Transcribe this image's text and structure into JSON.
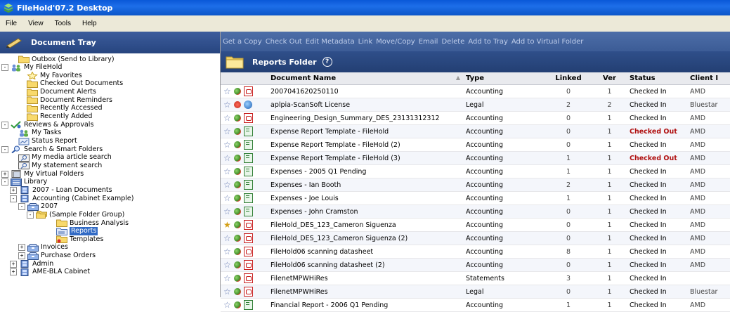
{
  "window": {
    "title": "FileHold'07.2 Desktop"
  },
  "menu": [
    "File",
    "View",
    "Tools",
    "Help"
  ],
  "tray": {
    "title": "Document Tray"
  },
  "tree": [
    {
      "label": "Outbox (Send to Library)",
      "icon": "folder-icon",
      "indent": 1,
      "expander": ""
    },
    {
      "label": "My FileHold",
      "icon": "users-icon",
      "indent": 0,
      "expander": "-"
    },
    {
      "label": "My Favorites",
      "icon": "star-icon",
      "indent": 2,
      "expander": ""
    },
    {
      "label": "Checked Out Documents",
      "icon": "folder-icon",
      "indent": 2,
      "expander": ""
    },
    {
      "label": "Document Alerts",
      "icon": "folder-icon",
      "indent": 2,
      "expander": ""
    },
    {
      "label": "Document Reminders",
      "icon": "folder-icon",
      "indent": 2,
      "expander": ""
    },
    {
      "label": "Recently Accessed",
      "icon": "folder-icon",
      "indent": 2,
      "expander": ""
    },
    {
      "label": "Recently Added",
      "icon": "folder-icon",
      "indent": 2,
      "expander": ""
    },
    {
      "label": "Reviews & Approvals",
      "icon": "approval-icon",
      "indent": 0,
      "expander": "-"
    },
    {
      "label": "My Tasks",
      "icon": "users-icon",
      "indent": 1,
      "expander": ""
    },
    {
      "label": "Status Report",
      "icon": "report-icon",
      "indent": 1,
      "expander": ""
    },
    {
      "label": "Search & Smart Folders",
      "icon": "search-icon",
      "indent": 0,
      "expander": "-"
    },
    {
      "label": "My media article search",
      "icon": "smart-folder-icon",
      "indent": 1,
      "expander": ""
    },
    {
      "label": "My statement search",
      "icon": "smart-folder-icon",
      "indent": 1,
      "expander": ""
    },
    {
      "label": "My Virtual Folders",
      "icon": "virtual-folder-icon",
      "indent": 0,
      "expander": "+"
    },
    {
      "label": "Library",
      "icon": "library-icon",
      "indent": 0,
      "expander": "-"
    },
    {
      "label": "2007 - Loan Documents",
      "icon": "cabinet-icon",
      "indent": 1,
      "expander": "+"
    },
    {
      "label": "Accounting (Cabinet Example)",
      "icon": "cabinet-icon",
      "indent": 1,
      "expander": "-"
    },
    {
      "label": "2007",
      "icon": "drawer-icon",
      "indent": 2,
      "expander": "-"
    },
    {
      "label": "(Sample Folder Group)",
      "icon": "folder-group-icon",
      "indent": 3,
      "expander": "-"
    },
    {
      "label": "Business Analysis",
      "icon": "folder-icon",
      "indent": 5,
      "expander": ""
    },
    {
      "label": "Reports",
      "icon": "folder-open-icon",
      "indent": 5,
      "expander": "",
      "selected": true
    },
    {
      "label": "Templates",
      "icon": "template-folder-icon",
      "indent": 5,
      "expander": ""
    },
    {
      "label": "Invoices",
      "icon": "drawer-icon",
      "indent": 2,
      "expander": "+"
    },
    {
      "label": "Purchase Orders",
      "icon": "drawer-icon",
      "indent": 2,
      "expander": "+"
    },
    {
      "label": "Admin",
      "icon": "cabinet-icon",
      "indent": 1,
      "expander": "+"
    },
    {
      "label": "AME-BLA Cabinet",
      "icon": "cabinet-icon",
      "indent": 1,
      "expander": "+"
    }
  ],
  "toolbar": [
    "Get a Copy",
    "Check Out",
    "Edit Metadata",
    "Link",
    "Move/Copy",
    "Email",
    "Delete",
    "Add to Tray",
    "Add to Virtual Folder"
  ],
  "folder": {
    "title": "Reports Folder"
  },
  "table": {
    "columns": [
      "Document Name",
      "Type",
      "Linked",
      "Ver",
      "Status",
      "Client I"
    ],
    "rows": [
      {
        "name": "2007041620250110",
        "type": "Accounting",
        "linked": "0",
        "ver": "1",
        "status": "Checked In",
        "client": "AMD",
        "doc": "pdf",
        "star": "blue",
        "status_icon": "green"
      },
      {
        "name": "aplpia-ScanSoft License",
        "type": "Legal",
        "linked": "2",
        "ver": "2",
        "status": "Checked In",
        "client": "Bluestar",
        "doc": "web",
        "star": "blue",
        "status_icon": "red"
      },
      {
        "name": "Engineering_Design_Summary_DES_23131312312",
        "type": "Accounting",
        "linked": "0",
        "ver": "1",
        "status": "Checked In",
        "client": "AMD",
        "doc": "pdf",
        "star": "blue",
        "status_icon": "green"
      },
      {
        "name": "Expense Report Template - FileHold",
        "type": "Accounting",
        "linked": "0",
        "ver": "1",
        "status": "Checked Out",
        "client": "AMD",
        "doc": "xls",
        "star": "blue",
        "status_icon": "green"
      },
      {
        "name": "Expense Report Template - FileHold (2)",
        "type": "Accounting",
        "linked": "0",
        "ver": "1",
        "status": "Checked In",
        "client": "AMD",
        "doc": "xls",
        "star": "blue",
        "status_icon": "green"
      },
      {
        "name": "Expense Report Template - FileHold (3)",
        "type": "Accounting",
        "linked": "1",
        "ver": "1",
        "status": "Checked Out",
        "client": "AMD",
        "doc": "xls",
        "star": "blue",
        "status_icon": "green"
      },
      {
        "name": "Expenses  - 2005 Q1 Pending",
        "type": "Accounting",
        "linked": "1",
        "ver": "1",
        "status": "Checked In",
        "client": "AMD",
        "doc": "xls",
        "star": "blue",
        "status_icon": "green"
      },
      {
        "name": "Expenses - Ian Booth",
        "type": "Accounting",
        "linked": "2",
        "ver": "1",
        "status": "Checked In",
        "client": "AMD",
        "doc": "xls",
        "star": "blue",
        "status_icon": "green"
      },
      {
        "name": "Expenses - Joe Louis",
        "type": "Accounting",
        "linked": "1",
        "ver": "1",
        "status": "Checked In",
        "client": "AMD",
        "doc": "xls",
        "star": "blue",
        "status_icon": "green"
      },
      {
        "name": "Expenses - John Cramston",
        "type": "Accounting",
        "linked": "0",
        "ver": "1",
        "status": "Checked In",
        "client": "AMD",
        "doc": "xls",
        "star": "blue",
        "status_icon": "green"
      },
      {
        "name": "FileHold_DES_123_Cameron Siguenza",
        "type": "Accounting",
        "linked": "0",
        "ver": "1",
        "status": "Checked In",
        "client": "AMD",
        "doc": "pdf",
        "star": "gold",
        "status_icon": "green"
      },
      {
        "name": "FileHold_DES_123_Cameron Siguenza (2)",
        "type": "Accounting",
        "linked": "0",
        "ver": "1",
        "status": "Checked In",
        "client": "AMD",
        "doc": "pdf",
        "star": "blue",
        "status_icon": "green"
      },
      {
        "name": "FileHold06 scanning datasheet",
        "type": "Accounting",
        "linked": "8",
        "ver": "1",
        "status": "Checked In",
        "client": "AMD",
        "doc": "pdf",
        "star": "blue",
        "status_icon": "green"
      },
      {
        "name": "FileHold06 scanning datasheet (2)",
        "type": "Accounting",
        "linked": "0",
        "ver": "1",
        "status": "Checked In",
        "client": "AMD",
        "doc": "pdf",
        "star": "blue",
        "status_icon": "green"
      },
      {
        "name": "FilenetMPWHiRes",
        "type": "Statements",
        "linked": "3",
        "ver": "1",
        "status": "Checked In",
        "client": "",
        "doc": "pdf",
        "star": "blue",
        "status_icon": "green"
      },
      {
        "name": "FilenetMPWHiRes",
        "type": "Legal",
        "linked": "0",
        "ver": "1",
        "status": "Checked In",
        "client": "Bluestar",
        "doc": "pdf",
        "star": "blue",
        "status_icon": "green"
      },
      {
        "name": "Financial Report - 2006 Q1 Pending",
        "type": "Accounting",
        "linked": "1",
        "ver": "1",
        "status": "Checked In",
        "client": "AMD",
        "doc": "xls",
        "star": "blue",
        "status_icon": "green"
      }
    ]
  },
  "colors": {
    "title_bar": "#0a58d8",
    "panel_header": "#27457f",
    "checked_out": "#b01010"
  }
}
